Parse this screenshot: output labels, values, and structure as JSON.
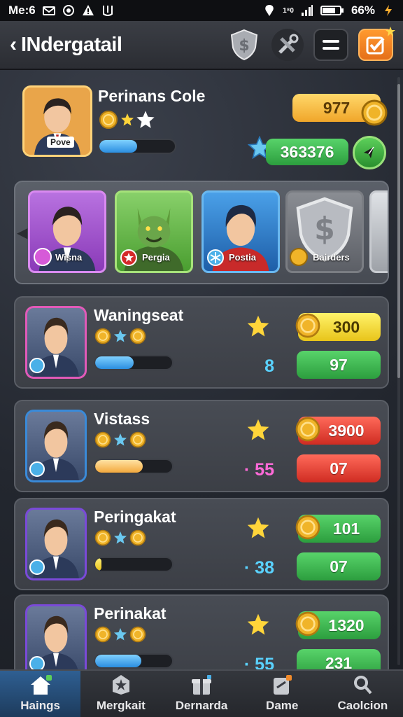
{
  "status_bar": {
    "time": "Me:6",
    "signal_text": "1⁸0",
    "battery": "66%"
  },
  "header": {
    "title": "INdergatail",
    "icons": [
      "back-icon",
      "shield-icon",
      "tools-icon",
      "menu-icon",
      "checkbox-icon"
    ]
  },
  "profile": {
    "name": "Perinans Cole",
    "badge": "Povе",
    "gold": "977",
    "score": "363376",
    "progress": 0.5
  },
  "characters": [
    {
      "label": "Wisna",
      "border": "#d65ad8"
    },
    {
      "label": "Pergia",
      "border": "#5cc13a"
    },
    {
      "label": "Postia",
      "border": "#2b8ee0"
    },
    {
      "label": "Bairders",
      "border": "#777a80"
    }
  ],
  "players": [
    {
      "name": "Waningseat",
      "rank": "8",
      "rank_color": "blue",
      "top_value": "300",
      "top_style": "yellow",
      "bottom_value": "97",
      "bottom_style": "green",
      "progress": 0.5,
      "bar": "blue",
      "frame": "#e15ab8"
    },
    {
      "name": "Vistass",
      "rank": "55",
      "rank_prefix": "·",
      "rank_color": "pink",
      "top_value": "3900",
      "top_style": "red",
      "bottom_value": "07",
      "bottom_style": "red",
      "progress": 0.62,
      "bar": "orange",
      "frame": "#3a8ad8"
    },
    {
      "name": "Peringakat",
      "rank": "38",
      "rank_prefix": "·",
      "rank_color": "blue",
      "top_value": "101",
      "top_style": "green",
      "bottom_value": "07",
      "bottom_style": "green",
      "progress": 0.08,
      "bar": "yellow",
      "frame": "#7a4ad8"
    },
    {
      "name": "Perinakat",
      "rank": "55",
      "rank_prefix": "·",
      "rank_color": "blue",
      "top_value": "1320",
      "top_style": "green",
      "bottom_value": "231",
      "bottom_style": "green",
      "progress": 0.6,
      "bar": "blue",
      "frame": "#7a4ad8"
    }
  ],
  "tabs": [
    {
      "label": "Haings",
      "icon": "home-icon"
    },
    {
      "label": "Mergkait",
      "icon": "star-badge-icon"
    },
    {
      "label": "Dernarda",
      "icon": "gift-icon"
    },
    {
      "label": "Dame",
      "icon": "card-icon"
    },
    {
      "label": "Caolcion",
      "icon": "search-icon"
    }
  ]
}
